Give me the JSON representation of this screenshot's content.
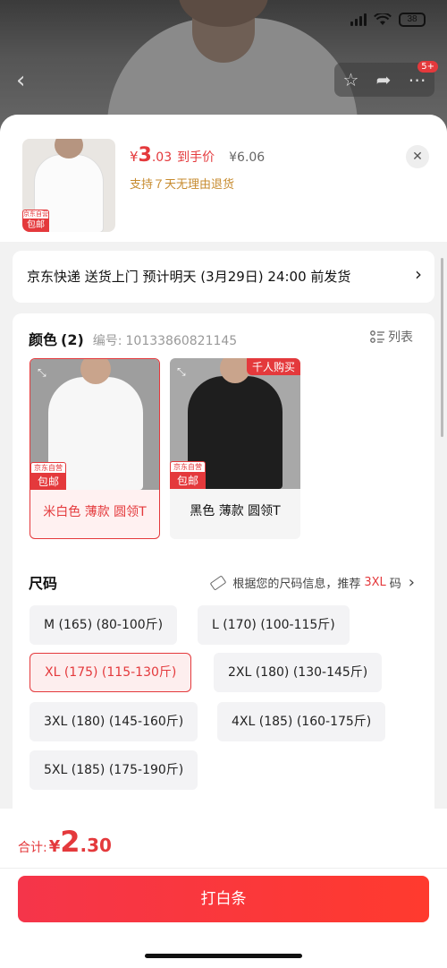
{
  "status_bar": {
    "battery": "38"
  },
  "header": {
    "cart_badge": "5+"
  },
  "product": {
    "currency": "¥",
    "price_int": "3",
    "price_dec": ".03",
    "price_tag": "到手价",
    "original_price": "¥6.06",
    "return_policy": "支持７天无理由退货",
    "tag_jd": "京东自营",
    "tag_free_ship": "包邮"
  },
  "shipping": {
    "text": "京东快递 送货上门 预计明天 (3月29日) 24:00 前发货"
  },
  "color_section": {
    "title": "颜色",
    "count": "(2)",
    "sku_label": "编号:",
    "sku": "10133860821145",
    "list_label": "列表",
    "swatches": [
      {
        "label": "米白色 薄款 圆领T",
        "selected": true
      },
      {
        "label": "黑色 薄款 圆领T",
        "selected": false,
        "hot": "千人购买"
      }
    ]
  },
  "size_section": {
    "title": "尺码",
    "rec_prefix": "根据您的尺码信息，推荐",
    "rec_size": "3XL",
    "rec_suffix": "码",
    "sizes": [
      "M (165) (80-100斤)",
      "L (170) (100-115斤)",
      "XL (175) (115-130斤)",
      "2XL (180) (130-145斤)",
      "3XL (180) (145-160斤)",
      "4XL (185) (160-175斤)",
      "5XL (185) (175-190斤)"
    ],
    "selected": "XL (175) (115-130斤)"
  },
  "footer": {
    "total_label": "合计:",
    "total_currency": "¥",
    "total_int": "2",
    "total_dec": ".30",
    "button": "打白条"
  },
  "colors": {
    "accent": "#e4393c",
    "gold": "#c78b2f"
  }
}
